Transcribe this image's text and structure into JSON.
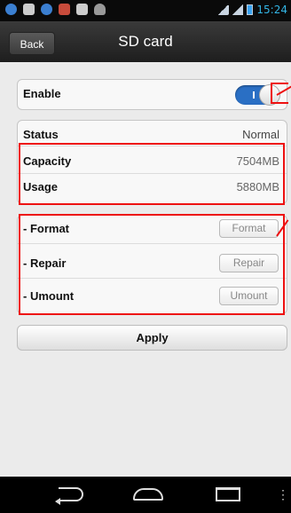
{
  "status_bar": {
    "time": "15:24",
    "notification_icons": [
      "app-icon",
      "cat-icon",
      "app-icon",
      "app-icon",
      "cat-icon",
      "owl-icon"
    ]
  },
  "title_bar": {
    "back_label": "Back",
    "title": "SD card"
  },
  "enable": {
    "label": "Enable",
    "toggle_on": true
  },
  "info": {
    "status_label": "Status",
    "status_value": "Normal",
    "capacity_label": "Capacity",
    "capacity_value": "7504MB",
    "usage_label": "Usage",
    "usage_value": "5880MB"
  },
  "actions": {
    "format_label": "- Format",
    "format_button": "Format",
    "repair_label": "- Repair",
    "repair_button": "Repair",
    "umount_label": "- Umount",
    "umount_button": "Umount"
  },
  "apply_label": "Apply",
  "colors": {
    "annotation": "#e11111",
    "toggle_on": "#2a6fc4",
    "clock": "#33b5e5"
  }
}
